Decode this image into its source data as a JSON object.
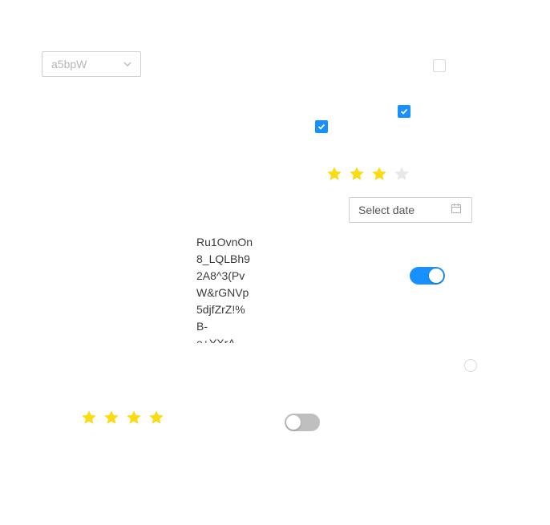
{
  "select": {
    "value": "a5bpW",
    "icon": "chevron-down-icon"
  },
  "checkboxes": [
    {
      "id": "checkbox-top-right",
      "checked": false
    },
    {
      "id": "checkbox-middle",
      "checked": true
    },
    {
      "id": "checkbox-left",
      "checked": true
    }
  ],
  "ratings": [
    {
      "id": "rating-upper",
      "value": 3,
      "max": 4
    },
    {
      "id": "rating-lower",
      "value": 4,
      "max": 4
    }
  ],
  "datepicker": {
    "placeholder": "Select date",
    "icon": "calendar-icon"
  },
  "text_block": {
    "lines": [
      "Ru1OvnOn",
      "8_LQLBh9",
      "2A8^3(Pv",
      "W&rGNVp",
      "5djfZrZ!%",
      "B-",
      "e+YXrA"
    ]
  },
  "toggles": [
    {
      "id": "toggle-upper",
      "on": true
    },
    {
      "id": "toggle-lower",
      "on": false
    }
  ],
  "radio": {
    "checked": false
  },
  "colors": {
    "accent": "#1890ff",
    "star_filled": "#fadb14",
    "star_empty": "#e8e8e8",
    "toggle_off": "#bfbfbf"
  }
}
